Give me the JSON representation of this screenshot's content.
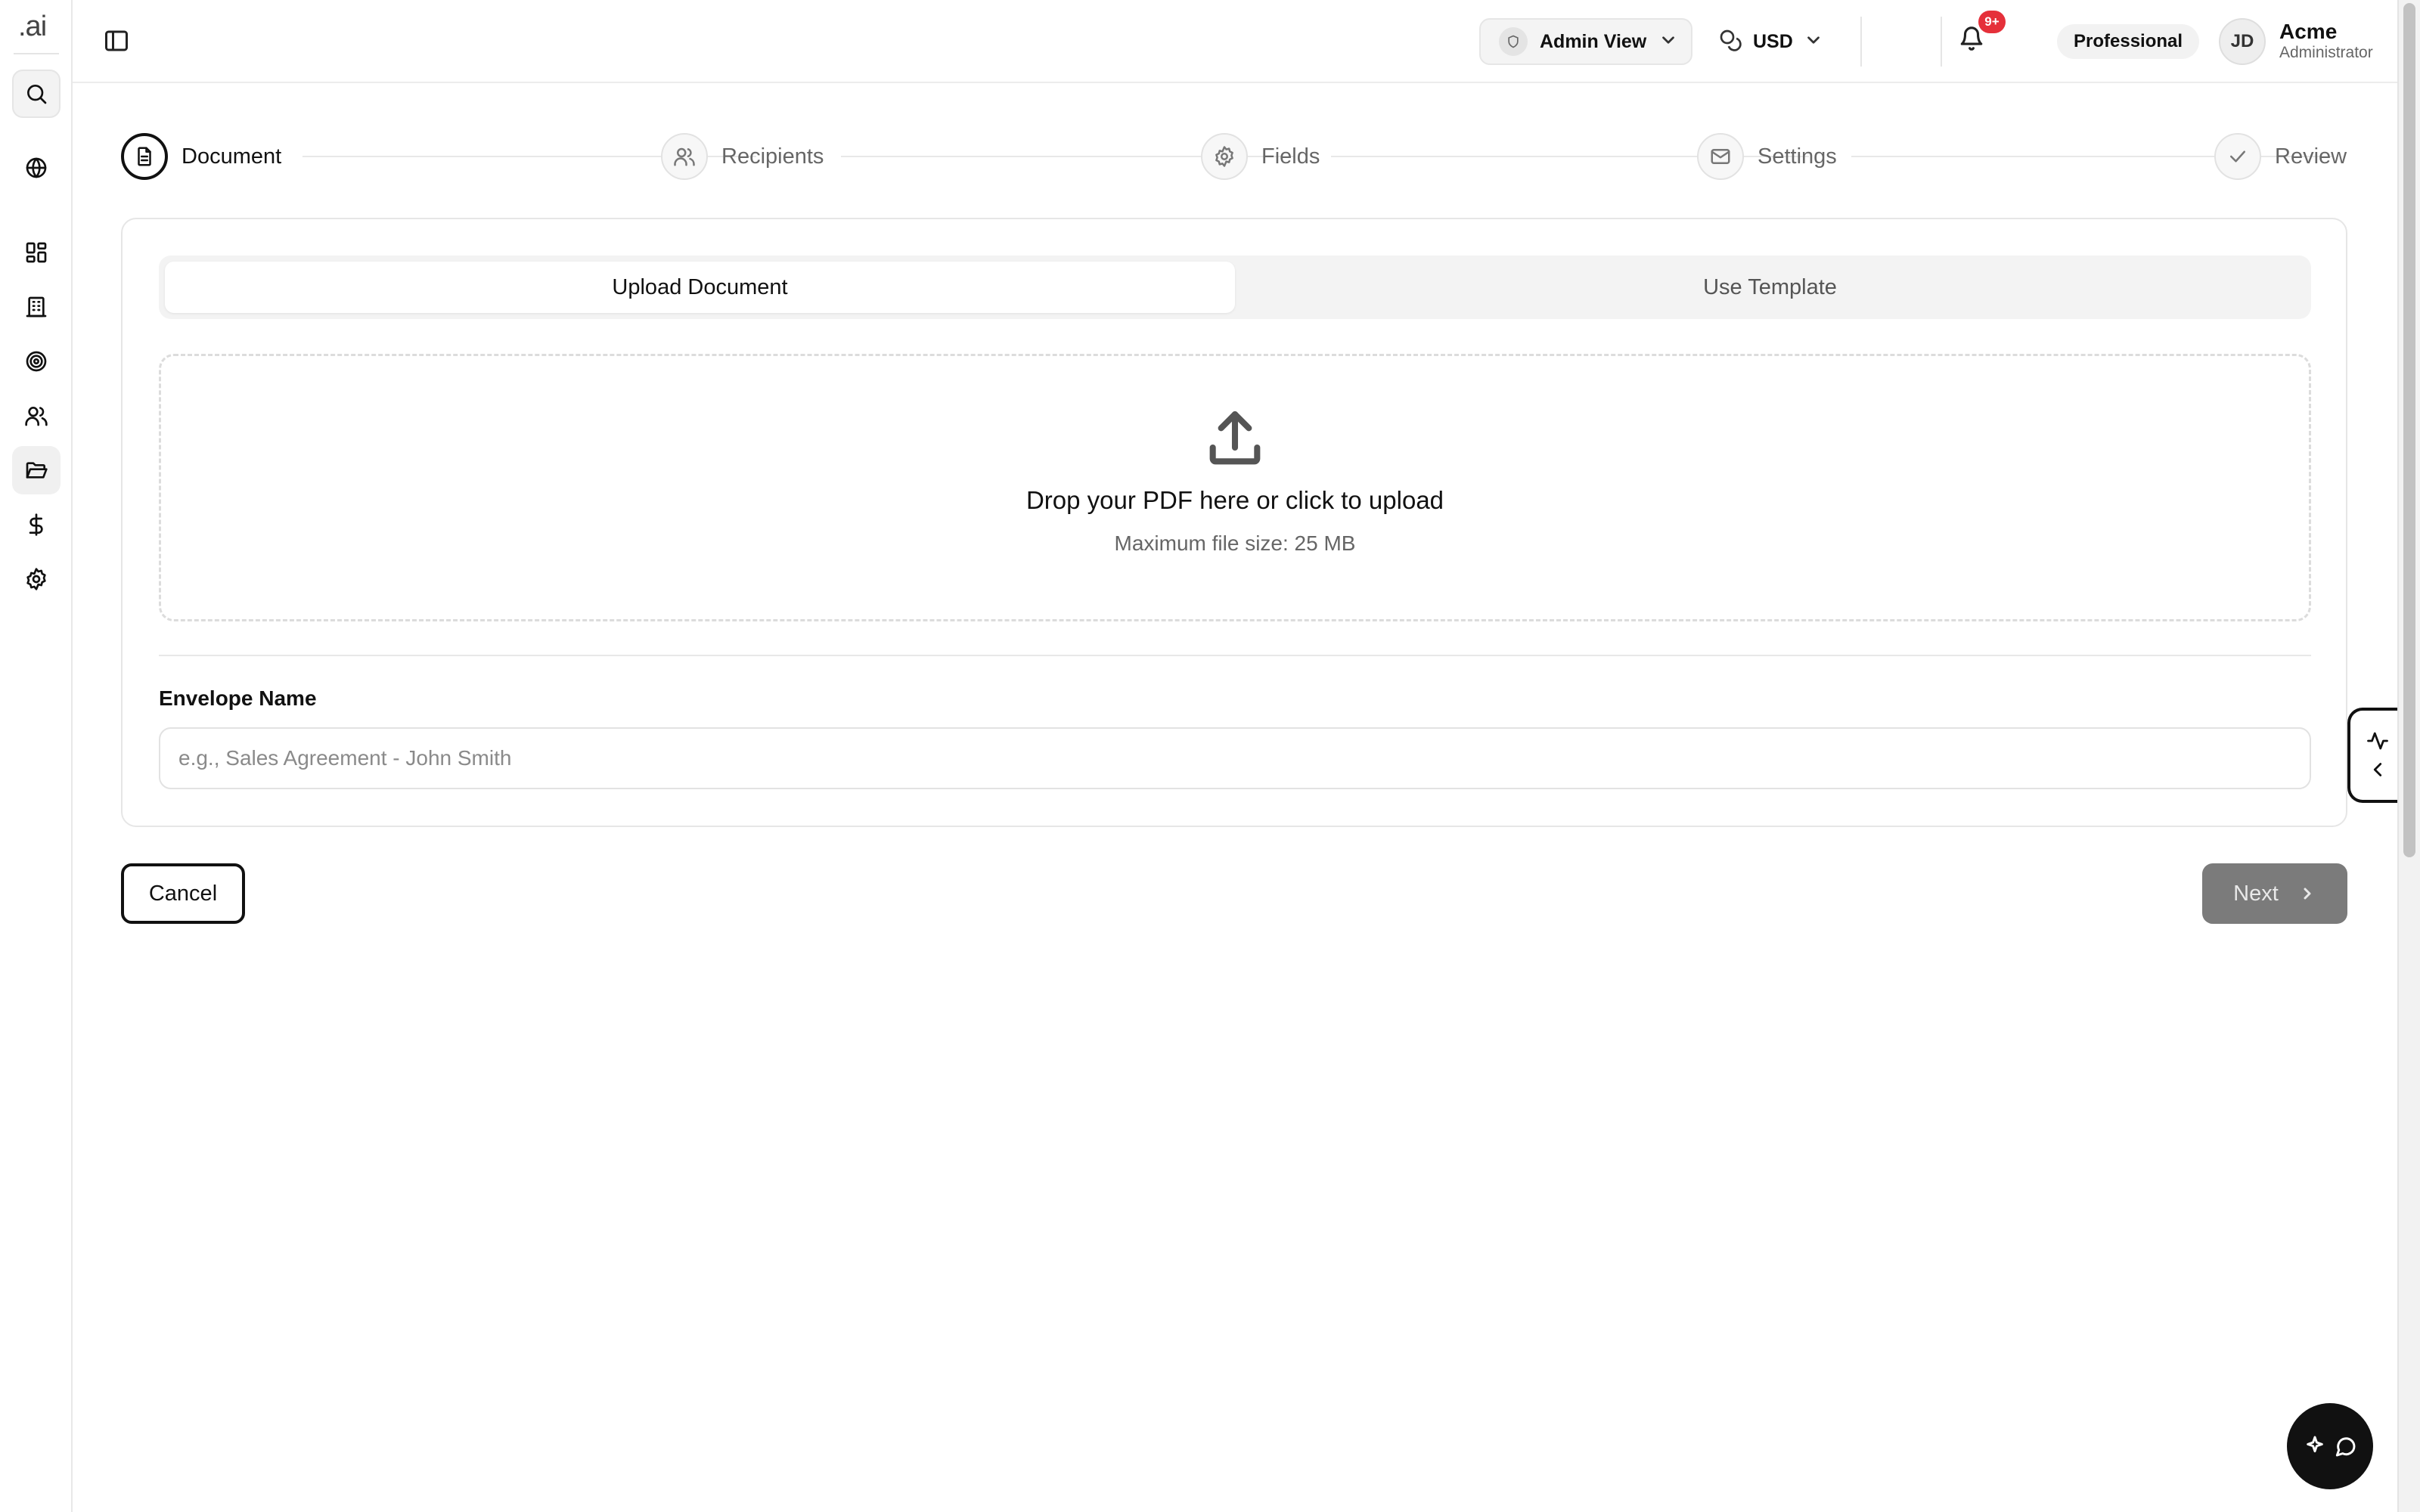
{
  "rail": {
    "logo": ".ai",
    "items": [
      {
        "icon": "search-icon"
      },
      {
        "icon": "globe-icon"
      },
      {
        "icon": "dashboard-icon"
      },
      {
        "icon": "building-icon"
      },
      {
        "icon": "target-icon"
      },
      {
        "icon": "users-icon"
      },
      {
        "icon": "folder-open-icon",
        "active": true
      },
      {
        "icon": "dollar-icon"
      },
      {
        "icon": "gear-icon"
      }
    ]
  },
  "header": {
    "view_label": "Admin View",
    "currency_label": "USD",
    "notifications_badge": "9+",
    "plan_label": "Professional",
    "user": {
      "initials": "JD",
      "name": "Acme",
      "role": "Administrator"
    }
  },
  "stepper": {
    "steps": [
      {
        "label": "Document",
        "icon": "document-icon",
        "active": true
      },
      {
        "label": "Recipients",
        "icon": "users-icon",
        "active": false
      },
      {
        "label": "Fields",
        "icon": "gear-icon",
        "active": false
      },
      {
        "label": "Settings",
        "icon": "mail-icon",
        "active": false
      },
      {
        "label": "Review",
        "icon": "check-icon",
        "active": false
      }
    ]
  },
  "card": {
    "tabs": [
      {
        "label": "Upload Document",
        "active": true
      },
      {
        "label": "Use Template",
        "active": false
      }
    ],
    "dropzone": {
      "title": "Drop your PDF here or click to upload",
      "subtitle": "Maximum file size: 25 MB"
    },
    "envelope": {
      "label": "Envelope Name",
      "placeholder": "e.g., Sales Agreement - John Smith",
      "value": ""
    }
  },
  "actions": {
    "cancel_label": "Cancel",
    "next_label": "Next"
  },
  "colors": {
    "accent": "#111111",
    "badge": "#e5303a",
    "next_disabled": "#7b7b7b"
  }
}
